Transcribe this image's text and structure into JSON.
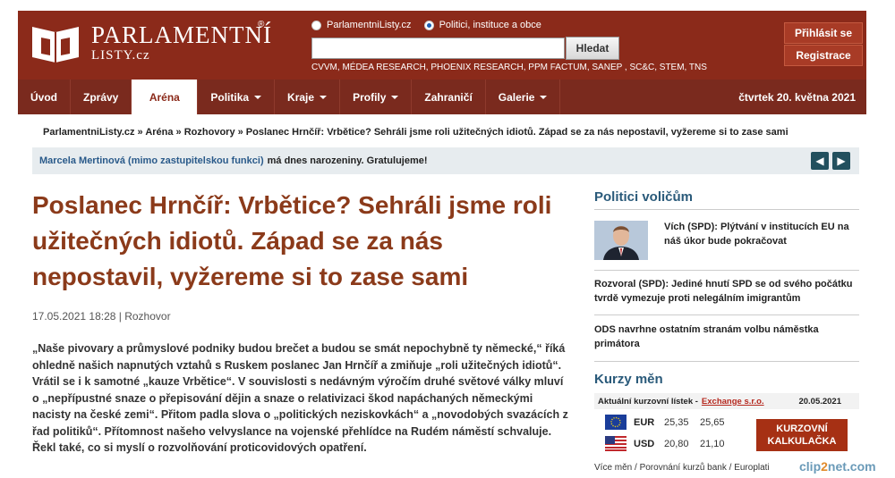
{
  "brand": {
    "line1": "PARLAMENTNÍ",
    "line2": "LISTY.cz",
    "reg": "®"
  },
  "search": {
    "radio1": "ParlamentniListy.cz",
    "radio2": "Politici, instituce a obce",
    "placeholder": "",
    "button": "Hledat",
    "agencies": "CVVM, MÉDEA RESEARCH, PHOENIX RESEARCH, PPM FACTUM, SANEP , SC&C, STEM, TNS"
  },
  "auth": {
    "login": "Přihlásit se",
    "register": "Registrace"
  },
  "nav": {
    "items": [
      "Úvod",
      "Zprávy",
      "Aréna",
      "Politika",
      "Kraje",
      "Profily",
      "Zahraničí",
      "Galerie"
    ],
    "date": "čtvrtek 20. května 2021"
  },
  "breadcrumb": "ParlamentniListy.cz » Aréna » Rozhovory » Poslanec Hrnčíř: Vrbětice? Sehráli jsme roli užitečných idiotů. Západ se za nás nepostavil, vyžereme si to zase sami",
  "birthday": {
    "name": "Marcela Mertinová (mimo zastupitelskou funkci)",
    "text": "má dnes narozeniny. Gratulujeme!"
  },
  "article": {
    "title": "Poslanec Hrnčíř: Vrbětice? Sehráli jsme roli užitečných idiotů. Západ se za nás nepostavil, vyžereme si to zase sami",
    "meta": "17.05.2021 18:28 | Rozhovor",
    "perex": "„Naše pivovary a průmyslové podniky budou brečet a budou se smát nepochybně ty německé,“ říká ohledně našich napnutých vztahů s Ruskem poslanec Jan Hrnčíř a zmiňuje „roli užitečných idiotů“. Vrátil se i k samotné „kauze Vrbětice“. V souvislosti s nedávným výročím druhé světové války mluví o „nepřípustné snaze o přepisování dějin a snaze o relativizaci škod napáchaných německými nacisty na české zemi“. Přitom padla slova o „politických neziskovkách“ a „novodobých svazácích z řad politiků“. Přítomnost našeho velvyslance na vojenské přehlídce na Rudém náměstí schvaluje. Řekl také, co si myslí o rozvolňování proticovidových opatření."
  },
  "sidebar": {
    "section_title": "Politici voličům",
    "items": [
      "Vích (SPD): Plýtvání v institucích EU na náš úkor bude pokračovat",
      "Rozvoral (SPD): Jediné hnutí SPD se od svého počátku tvrdě vymezuje proti nelegálním imigrantům",
      "ODS navrhne ostatním stranám volbu náměstka primátora"
    ]
  },
  "kurzy": {
    "title": "Kurzy měn",
    "label": "Aktuální kurzovní lístek -",
    "exchange": "Exchange s.r.o.",
    "date": "20.05.2021",
    "rows": [
      {
        "code": "EUR",
        "buy": "25,35",
        "sell": "25,65"
      },
      {
        "code": "USD",
        "buy": "20,80",
        "sell": "21,10"
      }
    ],
    "calc_button": "KURZOVNÍ KALKULAČKA",
    "links": "Více měn / Porovnání kurzů bank / Europlati"
  },
  "watermark": {
    "a": "clip",
    "b": "2",
    "c": "net.com"
  },
  "colors": {
    "brand": "#8b2a1a",
    "nav": "#7a2a1e",
    "title": "#8b3a1a",
    "sidebar_title": "#2a5a7a"
  }
}
